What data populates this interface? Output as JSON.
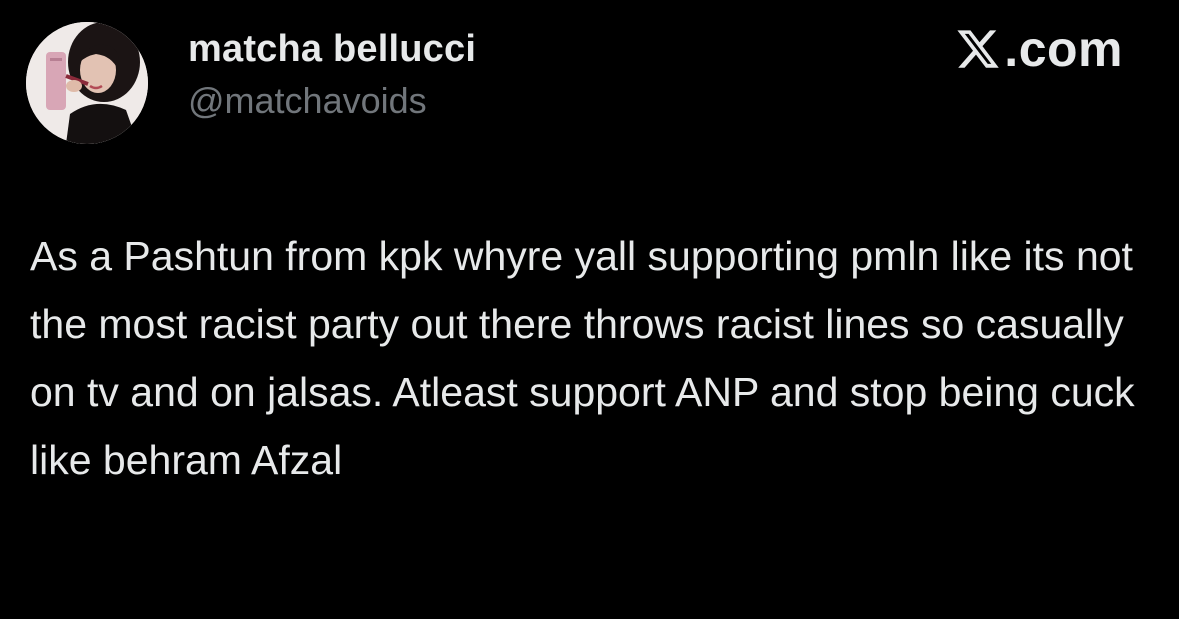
{
  "author": {
    "display_name": "matcha bellucci",
    "handle": "@matchavoids",
    "avatar_icon": "profile-photo"
  },
  "brand": {
    "icon": "x-logo-icon",
    "text": ".com"
  },
  "tweet": {
    "text": "As a Pashtun from kpk whyre yall supporting pmln like its not the most racist party out there throws racist lines so casually on tv and on jalsas. Atleast support ANP and stop being cuck like behram Afzal"
  },
  "colors": {
    "background": "#000000",
    "primary_text": "#e7e9ea",
    "secondary_text": "#71767b"
  }
}
